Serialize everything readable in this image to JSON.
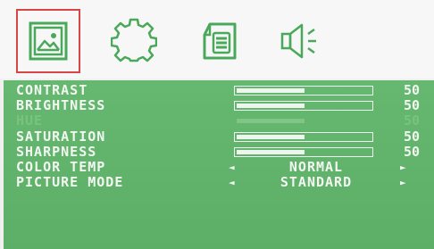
{
  "tabs": [
    {
      "icon": "picture-icon",
      "selected": true
    },
    {
      "icon": "gear-icon",
      "selected": false
    },
    {
      "icon": "document-icon",
      "selected": false
    },
    {
      "icon": "speaker-icon",
      "selected": false
    }
  ],
  "settings": [
    {
      "label": "CONTRAST",
      "value": "50",
      "level": 0.5,
      "enabled": true
    },
    {
      "label": "BRIGHTNESS",
      "value": "50",
      "level": 0.5,
      "enabled": true
    },
    {
      "label": "HUE",
      "value": "50",
      "level": 0.5,
      "enabled": false
    },
    {
      "label": "SATURATION",
      "value": "50",
      "level": 0.5,
      "enabled": true
    },
    {
      "label": "SHARPNESS",
      "value": "50",
      "level": 0.5,
      "enabled": true
    }
  ],
  "options": [
    {
      "label": "COLOR TEMP",
      "value": "NORMAL"
    },
    {
      "label": "PICTURE MODE",
      "value": "STANDARD"
    }
  ],
  "colors": {
    "panel": "#62b46c",
    "icon": "#4aa85a",
    "selection": "#d84545",
    "text": "#f2f7f2"
  }
}
